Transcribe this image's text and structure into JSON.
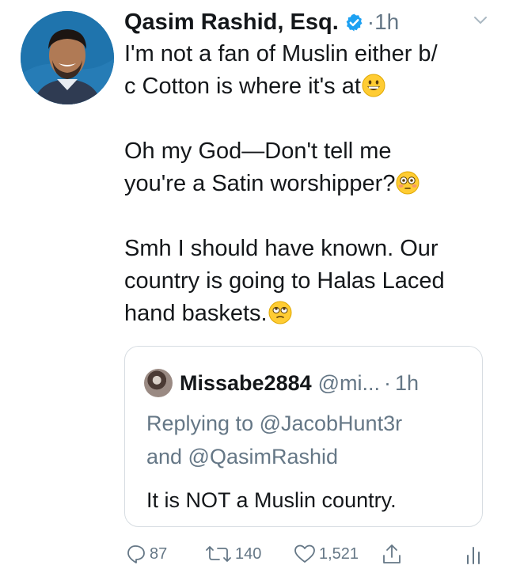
{
  "tweet": {
    "author_name": "Qasim Rashid, Esq.",
    "dot": "·",
    "time": "1h",
    "text_lines": [
      [
        "I'm not a fan of Muslin either b/",
        "c Cotton is where it's at"
      ],
      [
        "Oh my God—Don't tell me",
        "you're a Satin worshipper?"
      ],
      [
        "Smh I should have known. Our",
        "country is going to Halas Laced",
        "hand baskets."
      ]
    ]
  },
  "quoted": {
    "name": "Missabe2884",
    "handle": "@mi...",
    "dot": "·",
    "time": "1h",
    "replying_line1": "Replying to @JacobHunt3r",
    "replying_line2": "and @QasimRashid",
    "text": "It is NOT a Muslin country."
  },
  "actions": {
    "replies": "87",
    "retweets": "140",
    "likes": "1,521"
  },
  "colors": {
    "text": "#14171a",
    "muted": "#657786",
    "verified": "#1da1f2",
    "border": "#d7dde2"
  },
  "icons": [
    "verified-badge-icon",
    "chevron-down-icon",
    "grinning-face-emoji",
    "flushed-face-emoji",
    "eye-roll-emoji",
    "reply-icon",
    "retweet-icon",
    "like-icon",
    "share-icon",
    "analytics-icon"
  ]
}
